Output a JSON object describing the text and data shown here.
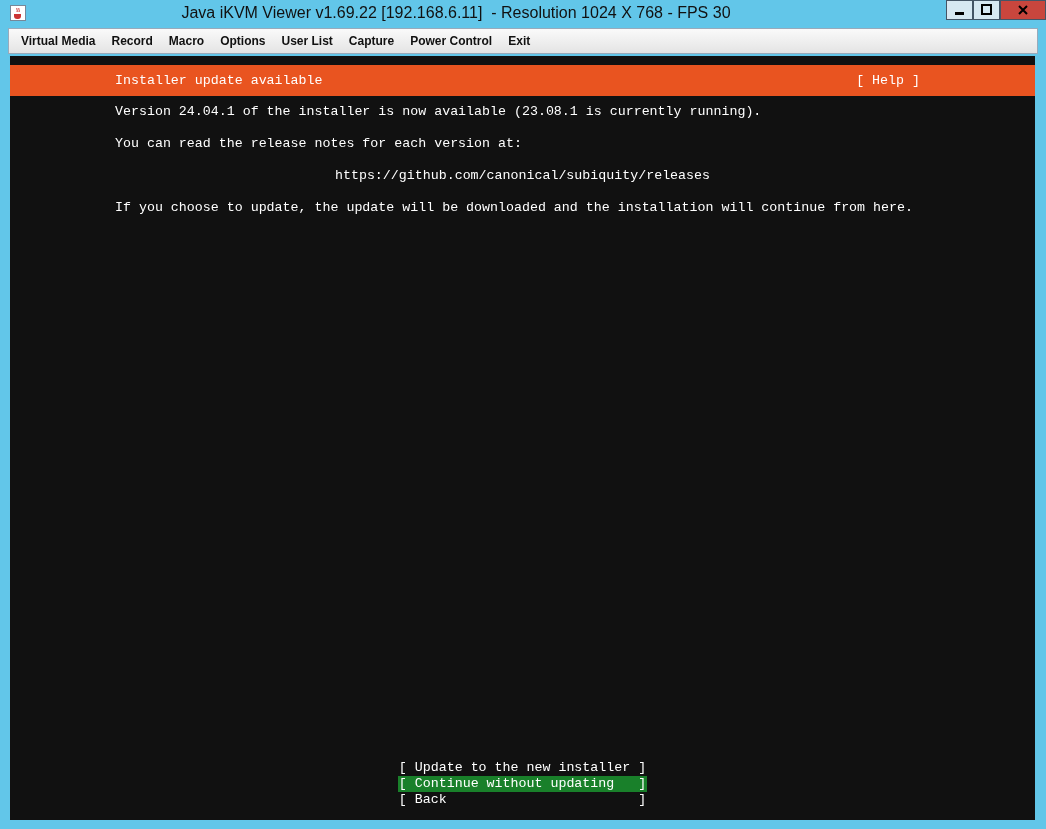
{
  "window": {
    "title": "Java iKVM Viewer v1.69.22 [192.168.6.11]  - Resolution 1024 X 768 - FPS 30"
  },
  "menu": [
    "Virtual Media",
    "Record",
    "Macro",
    "Options",
    "User List",
    "Capture",
    "Power Control",
    "Exit"
  ],
  "installer": {
    "header": "Installer update available",
    "help": "[ Help ]",
    "lines": [
      {
        "kind": "text",
        "text": "Version 24.04.1 of the installer is now available (23.08.1 is currently running)."
      },
      {
        "kind": "text",
        "text": "You can read the release notes for each version at:"
      },
      {
        "kind": "link",
        "text": "https://github.com/canonical/subiquity/releases"
      },
      {
        "kind": "text",
        "text": "If you choose to update, the update will be downloaded and the installation will continue from here."
      }
    ],
    "options": [
      {
        "label": "[ Update to the new installer ]",
        "selected": false
      },
      {
        "label": "[ Continue without updating   ]",
        "selected": true
      },
      {
        "label": "[ Back                        ]",
        "selected": false
      }
    ]
  }
}
